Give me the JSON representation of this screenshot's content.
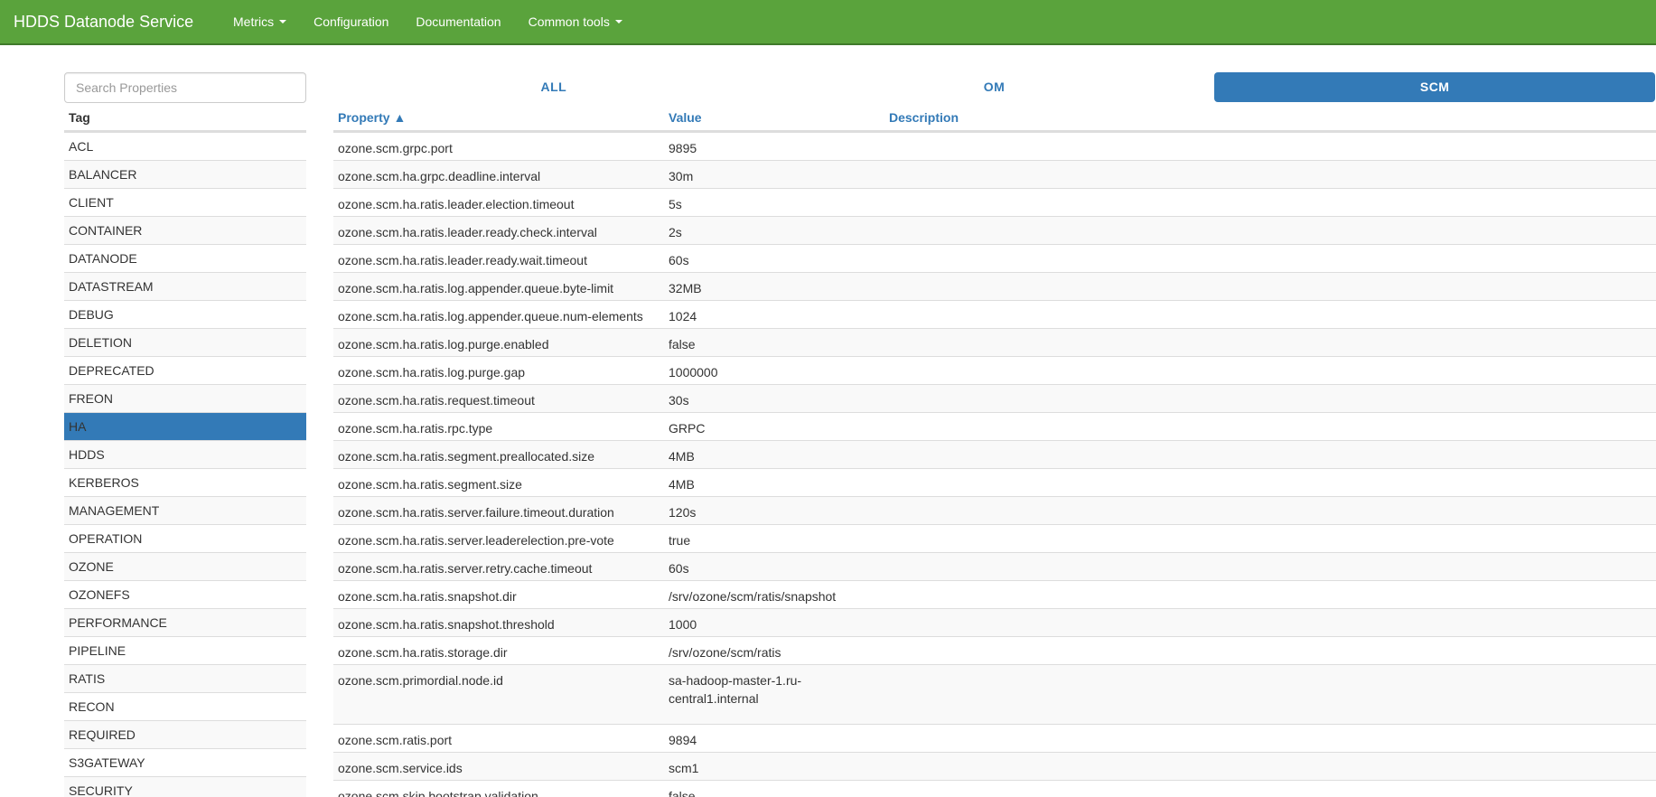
{
  "navbar": {
    "brand": "HDDS Datanode Service",
    "items": [
      {
        "label": "Metrics",
        "dropdown": true
      },
      {
        "label": "Configuration",
        "dropdown": false
      },
      {
        "label": "Documentation",
        "dropdown": false
      },
      {
        "label": "Common tools",
        "dropdown": true
      }
    ]
  },
  "search": {
    "placeholder": "Search Properties",
    "value": ""
  },
  "tags": {
    "header": "Tag",
    "items": [
      "ACL",
      "BALANCER",
      "CLIENT",
      "CONTAINER",
      "DATANODE",
      "DATASTREAM",
      "DEBUG",
      "DELETION",
      "DEPRECATED",
      "FREON",
      "HA",
      "HDDS",
      "KERBEROS",
      "MANAGEMENT",
      "OPERATION",
      "OZONE",
      "OZONEFS",
      "PERFORMANCE",
      "PIPELINE",
      "RATIS",
      "RECON",
      "REQUIRED",
      "S3GATEWAY",
      "SECURITY"
    ],
    "active": "HA"
  },
  "tabs": {
    "all": "ALL",
    "om": "OM",
    "scm": "SCM",
    "active": "SCM"
  },
  "table": {
    "headers": {
      "property": "Property ▲",
      "value": "Value",
      "description": "Description"
    },
    "rows": [
      {
        "property": "ozone.scm.grpc.port",
        "value": "9895",
        "description": ""
      },
      {
        "property": "ozone.scm.ha.grpc.deadline.interval",
        "value": "30m",
        "description": ""
      },
      {
        "property": "ozone.scm.ha.ratis.leader.election.timeout",
        "value": "5s",
        "description": ""
      },
      {
        "property": "ozone.scm.ha.ratis.leader.ready.check.interval",
        "value": "2s",
        "description": ""
      },
      {
        "property": "ozone.scm.ha.ratis.leader.ready.wait.timeout",
        "value": "60s",
        "description": ""
      },
      {
        "property": "ozone.scm.ha.ratis.log.appender.queue.byte-limit",
        "value": "32MB",
        "description": ""
      },
      {
        "property": "ozone.scm.ha.ratis.log.appender.queue.num-elements",
        "value": "1024",
        "description": ""
      },
      {
        "property": "ozone.scm.ha.ratis.log.purge.enabled",
        "value": "false",
        "description": ""
      },
      {
        "property": "ozone.scm.ha.ratis.log.purge.gap",
        "value": "1000000",
        "description": ""
      },
      {
        "property": "ozone.scm.ha.ratis.request.timeout",
        "value": "30s",
        "description": ""
      },
      {
        "property": "ozone.scm.ha.ratis.rpc.type",
        "value": "GRPC",
        "description": ""
      },
      {
        "property": "ozone.scm.ha.ratis.segment.preallocated.size",
        "value": "4MB",
        "description": ""
      },
      {
        "property": "ozone.scm.ha.ratis.segment.size",
        "value": "4MB",
        "description": ""
      },
      {
        "property": "ozone.scm.ha.ratis.server.failure.timeout.duration",
        "value": "120s",
        "description": ""
      },
      {
        "property": "ozone.scm.ha.ratis.server.leaderelection.pre-vote",
        "value": "true",
        "description": ""
      },
      {
        "property": "ozone.scm.ha.ratis.server.retry.cache.timeout",
        "value": "60s",
        "description": ""
      },
      {
        "property": "ozone.scm.ha.ratis.snapshot.dir",
        "value": "/srv/ozone/scm/ratis/snapshot",
        "description": ""
      },
      {
        "property": "ozone.scm.ha.ratis.snapshot.threshold",
        "value": "1000",
        "description": ""
      },
      {
        "property": "ozone.scm.ha.ratis.storage.dir",
        "value": "/srv/ozone/scm/ratis",
        "description": ""
      },
      {
        "property": "ozone.scm.primordial.node.id",
        "value": "sa-hadoop-master-1.ru-central1.internal",
        "description": ""
      },
      {
        "property": "ozone.scm.ratis.port",
        "value": "9894",
        "description": ""
      },
      {
        "property": "ozone.scm.service.ids",
        "value": "scm1",
        "description": ""
      },
      {
        "property": "ozone.scm.skip.bootstrap.validation",
        "value": "false",
        "description": ""
      }
    ]
  }
}
